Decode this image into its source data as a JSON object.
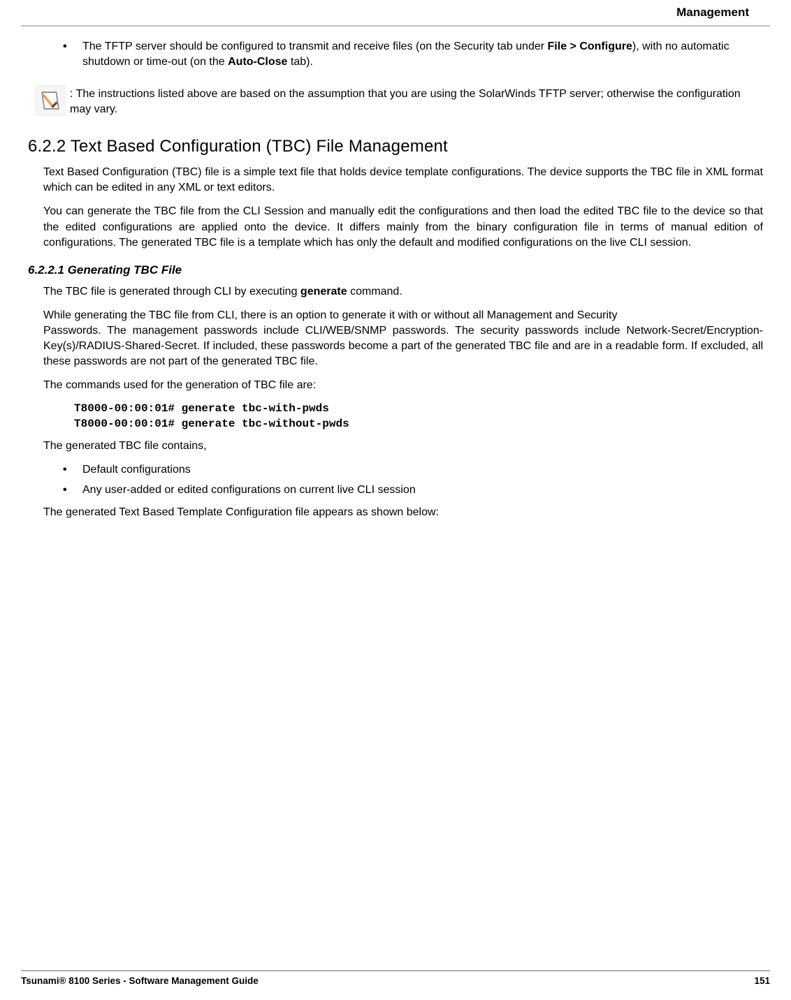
{
  "header": {
    "title": "Management"
  },
  "bullet_tftp": {
    "pre": "The TFTP server should be configured to transmit and receive files (on the Security tab under ",
    "b1": "File > Configure",
    "mid": "), with no automatic shutdown or time-out (on the ",
    "b2": "Auto-Close",
    "post": " tab)."
  },
  "note": ": The instructions listed above are based on the assumption that you are using the SolarWinds TFTP server; otherwise the configuration may vary.",
  "section_heading": "6.2.2 Text Based Configuration (TBC) File Management",
  "para1": "Text Based Configuration (TBC) file is a simple text file that holds device template configurations. The device supports the TBC file in XML format which can be edited in any XML or text editors.",
  "para2": "You can generate the TBC file from the CLI Session and manually edit the configurations and then load the edited TBC file to the device so that the edited configurations are applied onto the device. It differs mainly from the binary configuration file in terms of manual edition of configurations. The generated TBC file is a template which has only the default and modified configurations on the live CLI session.",
  "subheading": "6.2.2.1 Generating TBC File",
  "para3": {
    "pre": "The TBC file is generated through CLI by executing ",
    "b": "generate",
    "post": " command."
  },
  "para4a": "While generating the TBC file from CLI, there is an option to generate it with or without all Management and Security",
  "para4b": "Passwords. The management passwords include CLI/WEB/SNMP passwords. The security passwords include Network-Secret/Encryption-Key(s)/RADIUS-Shared-Secret. If included, these passwords become a part of the generated TBC file and are in a readable form. If excluded, all these passwords are not part of the generated TBC file.",
  "para5": "The commands used for the generation of TBC file are:",
  "cmd1": "T8000-00:00:01# generate tbc-with-pwds",
  "cmd2": "T8000-00:00:01# generate tbc-without-pwds",
  "para6": "The generated TBC file contains,",
  "bullet_a": "Default configurations",
  "bullet_b": "Any user-added or edited configurations on current live CLI session",
  "para7": "The generated Text Based Template Configuration file appears as shown below:",
  "footer": {
    "left": "Tsunami® 8100 Series - Software Management Guide",
    "right": "151"
  }
}
